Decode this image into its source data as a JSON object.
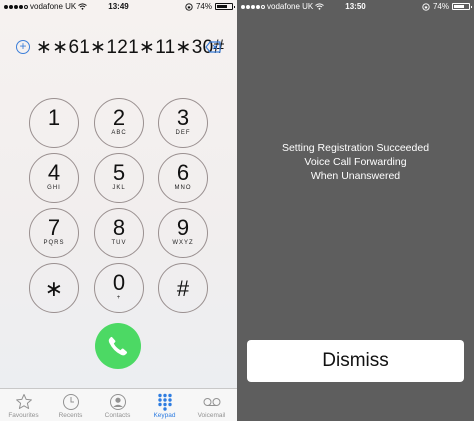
{
  "left": {
    "status": {
      "carrier": "vodafone UK",
      "time": "13:49",
      "battery": "74%",
      "battery_fraction": 0.74
    },
    "dialed_number": "∗∗61∗121∗11∗30#",
    "keys": [
      {
        "digit": "1",
        "letters": ""
      },
      {
        "digit": "2",
        "letters": "ABC"
      },
      {
        "digit": "3",
        "letters": "DEF"
      },
      {
        "digit": "4",
        "letters": "GHI"
      },
      {
        "digit": "5",
        "letters": "JKL"
      },
      {
        "digit": "6",
        "letters": "MNO"
      },
      {
        "digit": "7",
        "letters": "PQRS"
      },
      {
        "digit": "8",
        "letters": "TUV"
      },
      {
        "digit": "9",
        "letters": "WXYZ"
      },
      {
        "digit": "∗",
        "letters": ""
      },
      {
        "digit": "0",
        "letters": "+"
      },
      {
        "digit": "#",
        "letters": ""
      }
    ],
    "tabs": [
      {
        "label": "Favourites",
        "icon": "star-icon",
        "active": false
      },
      {
        "label": "Recents",
        "icon": "clock-icon",
        "active": false
      },
      {
        "label": "Contacts",
        "icon": "contact-icon",
        "active": false
      },
      {
        "label": "Keypad",
        "icon": "keypad-icon",
        "active": true
      },
      {
        "label": "Voicemail",
        "icon": "voicemail-icon",
        "active": false
      }
    ],
    "colors": {
      "call": "#4cd964",
      "accent": "#2f7de1"
    }
  },
  "right": {
    "status": {
      "carrier": "vodafone UK",
      "time": "13:50",
      "battery": "74%",
      "battery_fraction": 0.74
    },
    "message_lines": [
      "Setting Registration Succeeded",
      "Voice Call Forwarding",
      "When Unanswered"
    ],
    "dismiss_label": "Dismiss",
    "colors": {
      "background": "#5e5e5e"
    }
  }
}
